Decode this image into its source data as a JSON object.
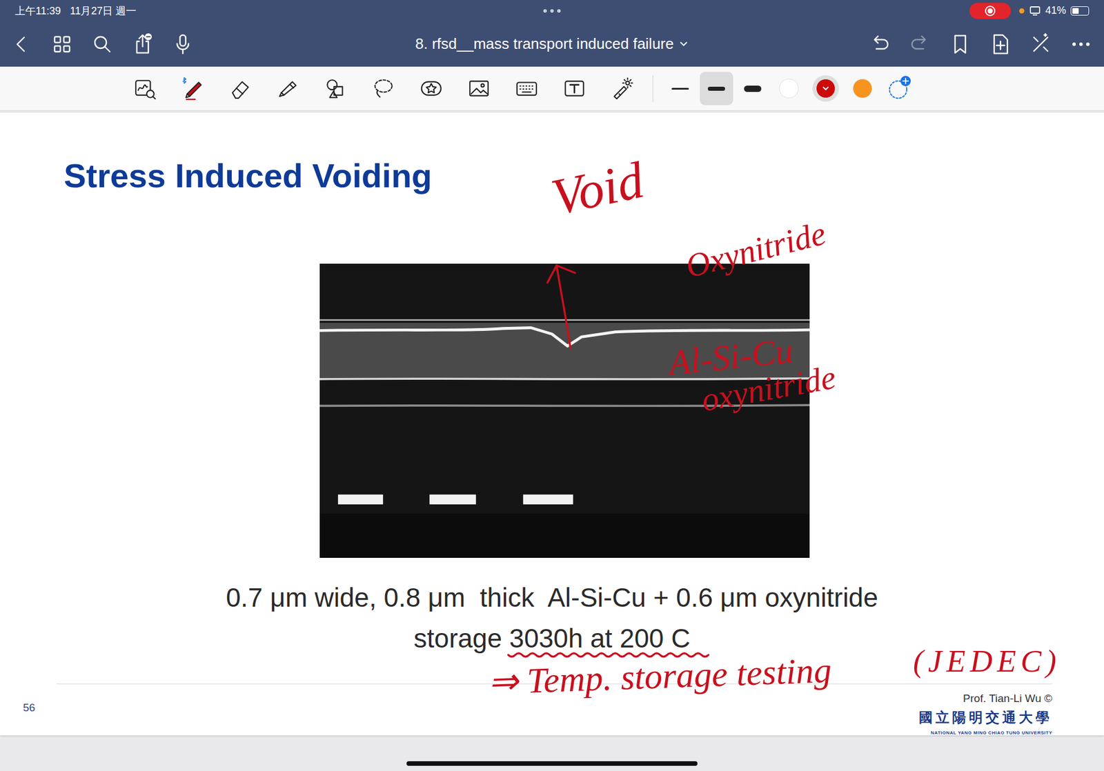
{
  "status_bar": {
    "time": "上午11:39",
    "date": "11月27日 週一",
    "recording": true,
    "battery": "41%",
    "battery_level": 0.41
  },
  "nav": {
    "title": "8. rfsd__mass transport induced failure"
  },
  "toolbar": {
    "tools": [
      {
        "kind": "zoom",
        "selected": false
      },
      {
        "kind": "pen",
        "selected": true
      },
      {
        "kind": "eraser",
        "selected": false
      },
      {
        "kind": "highlighter",
        "selected": false
      },
      {
        "kind": "shapes",
        "selected": false
      },
      {
        "kind": "lasso",
        "selected": false
      },
      {
        "kind": "sticker",
        "selected": false
      },
      {
        "kind": "image",
        "selected": false
      },
      {
        "kind": "keyboard",
        "selected": false
      },
      {
        "kind": "text",
        "selected": false
      },
      {
        "kind": "laser",
        "selected": false
      }
    ],
    "stroke_widths": [
      {
        "kind": "thin",
        "selected": false
      },
      {
        "kind": "medium",
        "selected": true
      },
      {
        "kind": "thick",
        "selected": false
      }
    ],
    "colors": [
      {
        "color": "#ffffff",
        "selected": false
      },
      {
        "color": "#cc0a0a",
        "selected": true
      },
      {
        "color": "#f7941d",
        "selected": false
      }
    ]
  },
  "slide": {
    "title": "Stress Induced Voiding",
    "caption": [
      "0.7 μm wide, 0.8 μm  thick  Al-Si-Cu + 0.6 μm oxynitride",
      "storage 3030h at 200 C"
    ],
    "page_number": "56",
    "credit": "Prof. Tian-Li Wu ©",
    "university": "國立陽明交通大學",
    "university_en": "NATIONAL YANG MING CHIAO TUNG UNIVERSITY"
  },
  "annotations": [
    {
      "text": "Void"
    },
    {
      "text": "Oxynitride"
    },
    {
      "text": "Al-Si-Cu"
    },
    {
      "text": "oxynitride"
    },
    {
      "text": "⇒ Temp. storage testing"
    },
    {
      "text": "(JEDEC)"
    }
  ]
}
